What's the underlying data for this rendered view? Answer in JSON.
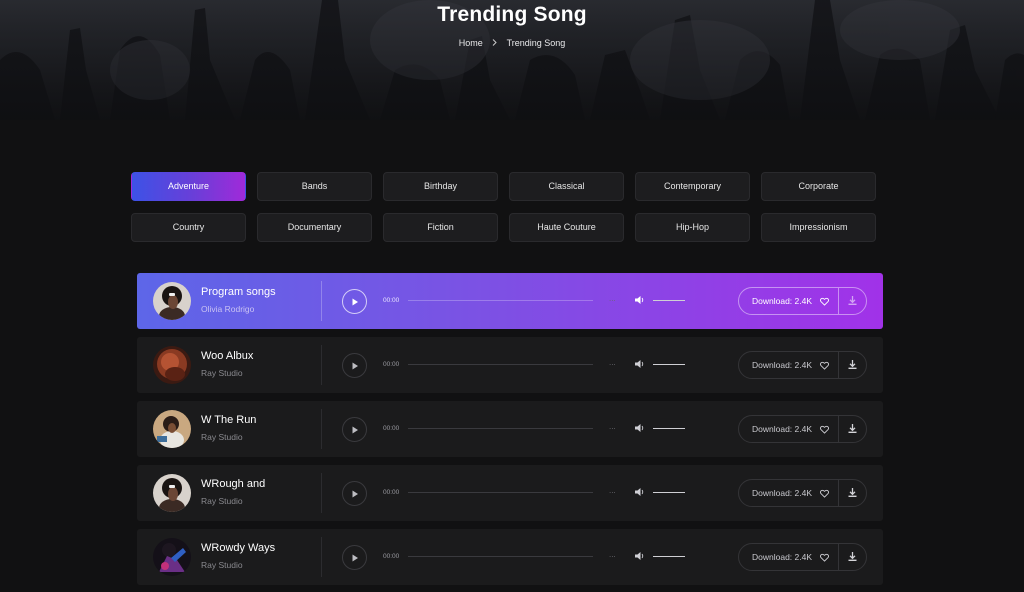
{
  "header": {
    "title": "Trending Song",
    "breadcrumb": {
      "home": "Home",
      "current": "Trending Song"
    }
  },
  "categories": [
    {
      "label": "Adventure",
      "active": true
    },
    {
      "label": "Bands"
    },
    {
      "label": "Birthday"
    },
    {
      "label": "Classical"
    },
    {
      "label": "Contemporary"
    },
    {
      "label": "Corporate"
    },
    {
      "label": "Country"
    },
    {
      "label": "Documentary"
    },
    {
      "label": "Fiction"
    },
    {
      "label": "Haute Couture"
    },
    {
      "label": "Hip-Hop"
    },
    {
      "label": "Impressionism"
    }
  ],
  "songs": [
    {
      "title": "Program songs",
      "artist": "Olivia Rodrigo",
      "time": "00:00",
      "downloads": "Download: 2.4K",
      "active": true
    },
    {
      "title": "Woo Albux",
      "artist": "Ray Studio",
      "time": "00:00",
      "downloads": "Download: 2.4K"
    },
    {
      "title": "W The Run",
      "artist": "Ray Studio",
      "time": "00:00",
      "downloads": "Download: 2.4K"
    },
    {
      "title": "WRough and",
      "artist": "Ray Studio",
      "time": "00:00",
      "downloads": "Download: 2.4K"
    },
    {
      "title": "WRowdy Ways",
      "artist": "Ray Studio",
      "time": "00:00",
      "downloads": "Download: 2.4K"
    }
  ],
  "player": {
    "dots": "...",
    "progress": 0
  },
  "icons": {
    "play": "play-icon",
    "volume": "volume-icon",
    "heart": "heart-icon",
    "download": "download-icon",
    "chevron": "chevron-right-icon"
  },
  "colors": {
    "accent_start": "#3d52e6",
    "accent_end": "#a02ad9",
    "background": "#111112",
    "row": "#1b1b1c"
  }
}
